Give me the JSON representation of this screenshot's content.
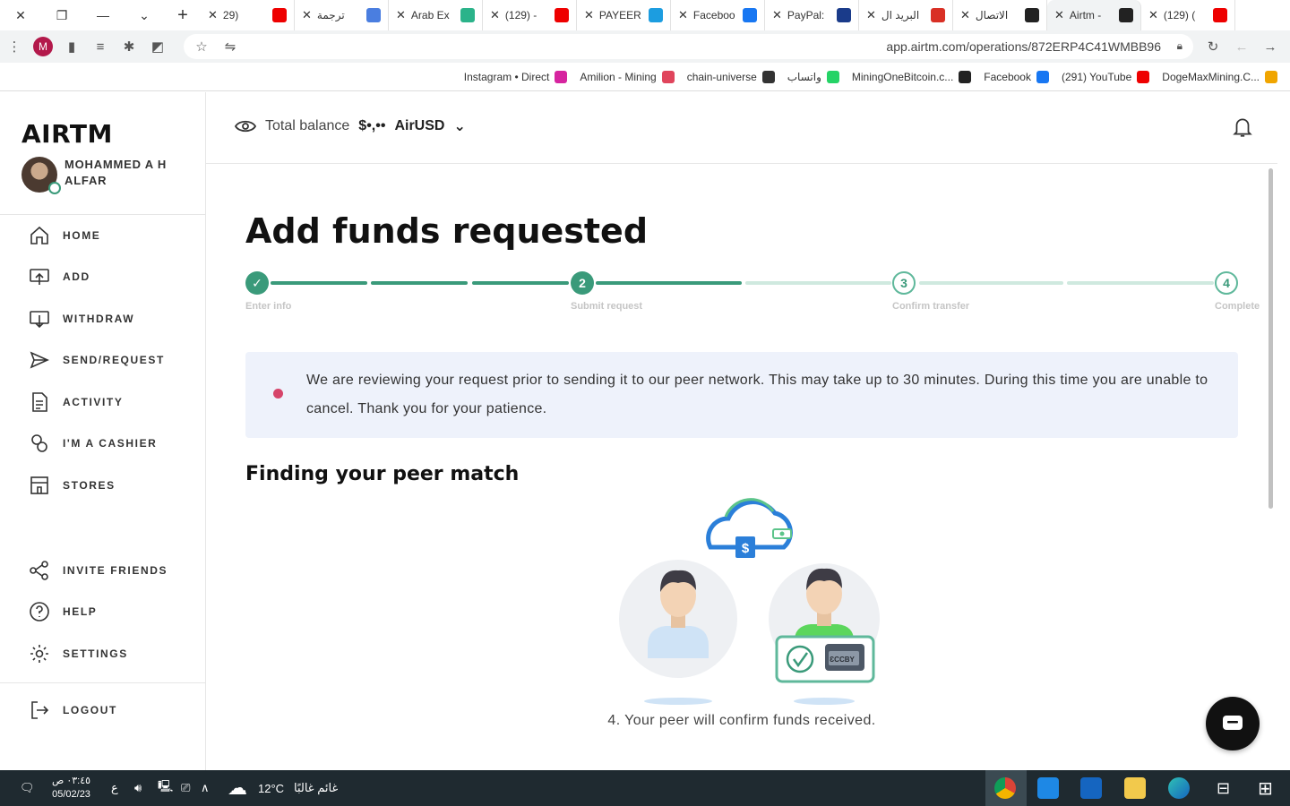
{
  "browser": {
    "tabs": [
      {
        "title": "29)",
        "color": "#e00"
      },
      {
        "title": "ترجمة",
        "color": "#4a7ee0"
      },
      {
        "title": "Arab Ex",
        "color": "#2bb38a"
      },
      {
        "title": "(129) -",
        "color": "#e00"
      },
      {
        "title": "PAYEER",
        "color": "#1c9de0"
      },
      {
        "title": "Faceboo",
        "color": "#1877f2"
      },
      {
        "title": "PayPal:",
        "color": "#1a3b8a"
      },
      {
        "title": "البريد ال",
        "color": "#d93025"
      },
      {
        "title": "الاتصال",
        "color": "#222"
      },
      {
        "title": "Airtm -",
        "color": "#222"
      },
      {
        "title": "(129) (",
        "color": "#e00"
      }
    ],
    "url": "app.airtm.com/operations/872ERP4C41WMBB96",
    "profile_initial": "M",
    "bookmarks": [
      {
        "label": "Instagram • Direct",
        "color": "#d6249f"
      },
      {
        "label": "Amilion - Mining",
        "color": "#e0455c"
      },
      {
        "label": "chain-universe",
        "color": "#333"
      },
      {
        "label": "واتساب",
        "color": "#25d366"
      },
      {
        "label": "MiningOneBitcoin.c...",
        "color": "#222"
      },
      {
        "label": "Facebook",
        "color": "#1877f2"
      },
      {
        "label": "(291) YouTube",
        "color": "#e00"
      },
      {
        "label": "DogeMaxMining.C...",
        "color": "#f0a500"
      }
    ]
  },
  "sidebar": {
    "logo": "AIRTM",
    "user_name": "MOHAMMED A H ALFAR",
    "nav": [
      {
        "label": "HOME",
        "icon": "home-icon"
      },
      {
        "label": "ADD",
        "icon": "add-funds-icon"
      },
      {
        "label": "WITHDRAW",
        "icon": "withdraw-icon"
      },
      {
        "label": "SEND/REQUEST",
        "icon": "send-icon"
      },
      {
        "label": "ACTIVITY",
        "icon": "document-icon"
      },
      {
        "label": "I'M A CASHIER",
        "icon": "cashier-icon"
      },
      {
        "label": "STORES",
        "icon": "store-icon"
      }
    ],
    "secondary": [
      {
        "label": "INVITE FRIENDS",
        "icon": "share-icon"
      },
      {
        "label": "HELP",
        "icon": "help-icon"
      },
      {
        "label": "SETTINGS",
        "icon": "gear-icon"
      }
    ],
    "logout": "LOGOUT"
  },
  "header": {
    "balance_label": "Total balance",
    "balance_amount": "$•,••",
    "currency": "AirUSD"
  },
  "page": {
    "title": "Add funds requested",
    "steps": [
      {
        "label": "Enter info",
        "marker": "✓",
        "state": "done"
      },
      {
        "label": "Submit request",
        "marker": "2",
        "state": "current"
      },
      {
        "label": "Confirm transfer",
        "marker": "3",
        "state": "todo"
      },
      {
        "label": "Complete",
        "marker": "4",
        "state": "todo"
      }
    ],
    "notice": "We are reviewing your request prior to sending it to our peer network. This may take up to 30 minutes. During this time you are unable to cancel. Thank you for your patience.",
    "subtitle": "Finding your peer match",
    "caption": "4. Your peer will confirm funds received.",
    "wallet_label": "ƐCCBY"
  },
  "taskbar": {
    "time": "٠٣:٤٥ ص",
    "date": "05/02/23",
    "lang": "ع",
    "weather_temp": "12°C",
    "weather_text": "غائم غالبًا"
  }
}
